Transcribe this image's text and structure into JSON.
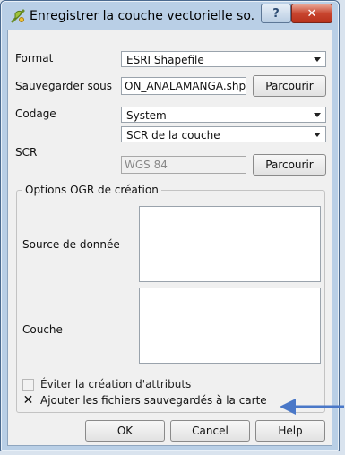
{
  "window": {
    "title": "Enregistrer la couche vectorielle so...",
    "help_glyph": "?",
    "close_glyph": "✕"
  },
  "form": {
    "format": {
      "label": "Format",
      "value": "ESRI Shapefile"
    },
    "save_as": {
      "label": "Sauvegarder sous",
      "value": "ON_ANALAMANGA.shp",
      "browse_label": "Parcourir"
    },
    "encoding": {
      "label": "Codage",
      "value": "System"
    },
    "crs": {
      "label": "SCR",
      "select_value": "SCR de la couche",
      "field_value": "WGS 84",
      "browse_label": "Parcourir"
    }
  },
  "ogr_options": {
    "title": "Options OGR de création",
    "datasource_label": "Source de donnée",
    "layer_label": "Couche"
  },
  "checkboxes": {
    "skip_attributes": {
      "label": "Éviter la création d'attributs",
      "checked": false,
      "enabled": false
    },
    "add_to_map": {
      "label": "Ajouter les fichiers sauvegardés à la carte",
      "checked": true,
      "enabled": true,
      "mark": "✕"
    }
  },
  "buttons": {
    "ok": "OK",
    "cancel": "Cancel",
    "help": "Help"
  },
  "colors": {
    "annotation_arrow": "#4a78c8",
    "titlebar": "#b9cfe6",
    "close_button": "#c8452e"
  }
}
